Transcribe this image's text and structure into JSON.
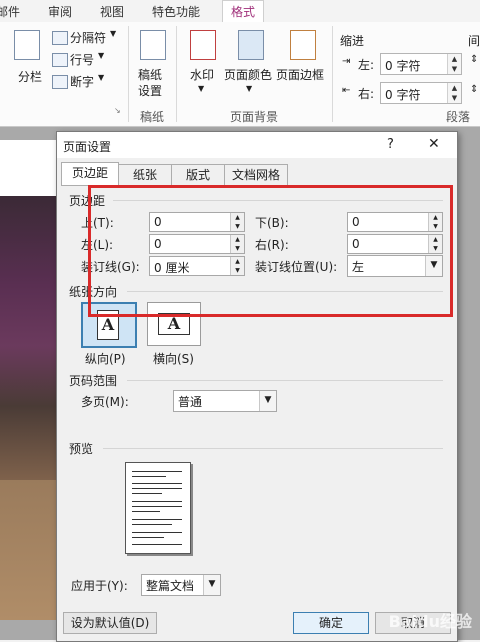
{
  "ribbon": {
    "tabs": [
      "邮件",
      "审阅",
      "视图",
      "特色功能",
      "格式"
    ],
    "active_tab": "格式",
    "items": {
      "columns": "分栏",
      "breaks": "分隔符",
      "line_numbers": "行号",
      "hyphenation": "断字",
      "paper_setup": "稿纸\n设置",
      "paper_setup_l1": "稿纸",
      "paper_setup_l2": "设置",
      "watermark": "水印",
      "page_color": "页面颜色",
      "page_border": "页面边框"
    },
    "groups": {
      "paper": "稿纸",
      "page_background": "页面背景",
      "paragraph": "段落"
    },
    "indent": {
      "title": "缩进",
      "left_label": "左:",
      "left_value": "0 字符",
      "right_label": "右:",
      "right_value": "0 字符",
      "spacing_title": "间"
    }
  },
  "dialog": {
    "title": "页面设置",
    "help": "?",
    "close": "✕",
    "tabs": [
      "页边距",
      "纸张",
      "版式",
      "文档网格"
    ],
    "active_tab": "页边距",
    "margins": {
      "section": "页边距",
      "top_label": "上(T):",
      "top_value": "0",
      "bottom_label": "下(B):",
      "bottom_value": "0",
      "left_label": "左(L):",
      "left_value": "0",
      "right_label": "右(R):",
      "right_value": "0",
      "gutter_label": "装订线(G):",
      "gutter_value": "0 厘米",
      "gutter_pos_label": "装订线位置(U):",
      "gutter_pos_value": "左"
    },
    "orientation": {
      "section": "纸张方向",
      "portrait": "纵向(P)",
      "landscape": "横向(S)",
      "glyph": "A",
      "selected": "portrait"
    },
    "pages": {
      "section": "页码范围",
      "multiple_label": "多页(M):",
      "multiple_value": "普通"
    },
    "preview": {
      "section": "预览",
      "apply_label": "应用于(Y):",
      "apply_value": "整篇文档"
    },
    "buttons": {
      "default": "设为默认值(D)",
      "ok": "确定",
      "cancel": "取消"
    }
  },
  "annotation": {
    "highlight_color": "#d92a2a"
  },
  "watermark_text": "Baidu经验"
}
